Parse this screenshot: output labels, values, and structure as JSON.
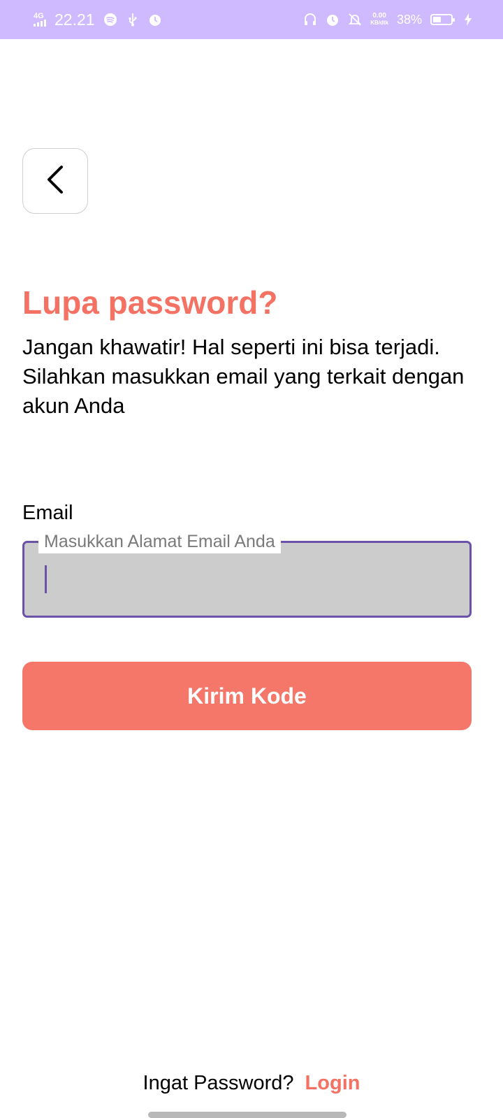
{
  "status_bar": {
    "network": "4G",
    "time": "22.21",
    "speed_value": "0.00",
    "speed_unit": "KB/dtk",
    "battery_percent": "38%",
    "battery_level": 0.38,
    "left_icons": [
      "spotify-icon",
      "usb-icon",
      "alarm-icon"
    ],
    "right_icons": [
      "headphones-icon",
      "alarm-icon",
      "notifications-off-icon",
      "charging-icon"
    ]
  },
  "back_button": {
    "icon": "chevron-left-icon"
  },
  "title": "Lupa password?",
  "description": {
    "line1": "Jangan khawatir! Hal seperti ini bisa terjadi.",
    "line2": "Silahkan masukkan email yang terkait dengan akun Anda"
  },
  "email": {
    "label": "Email",
    "placeholder": "Masukkan Alamat Email Anda",
    "value": ""
  },
  "submit_label": "Kirim Kode",
  "footer": {
    "question": "Ingat Password?",
    "login_label": "Login"
  },
  "colors": {
    "accent": "#f47263",
    "button": "#f5776a",
    "status_bar": "#d0baff",
    "field_border": "#6952a8",
    "field_background": "#cccccc"
  }
}
